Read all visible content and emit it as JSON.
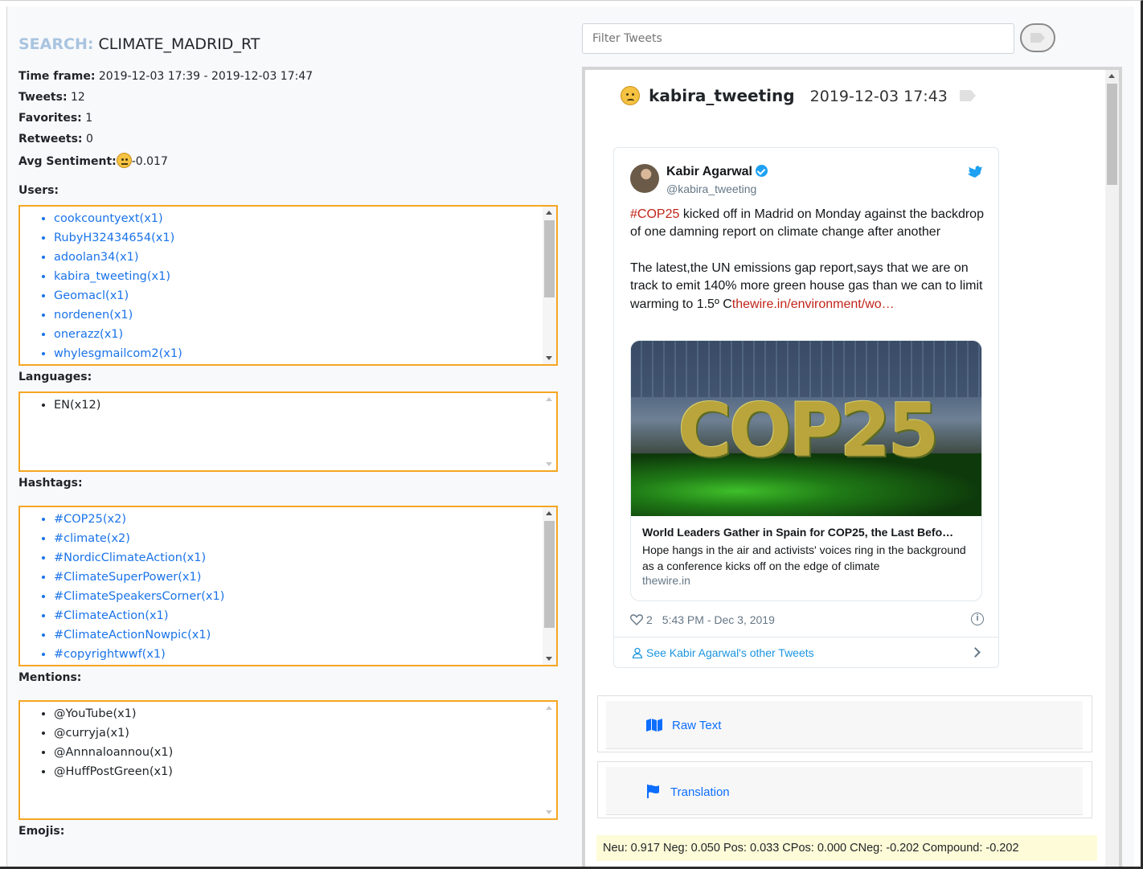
{
  "search": {
    "label": "SEARCH:",
    "value": "CLIMATE_MADRID_RT"
  },
  "stats": {
    "time_frame_label": "Time frame:",
    "time_frame": "2019-12-03 17:39 - 2019-12-03 17:47",
    "tweets_label": "Tweets:",
    "tweets": "12",
    "favorites_label": "Favorites:",
    "favorites": "1",
    "retweets_label": "Retweets:",
    "retweets": "0",
    "sentiment_label": "Avg Sentiment:",
    "sentiment": "-0.017"
  },
  "users": {
    "label": "Users:",
    "items": [
      "cookcountyext(x1)",
      "RubyH32434654(x1)",
      "adoolan34(x1)",
      "kabira_tweeting(x1)",
      "Geomacl(x1)",
      "nordenen(x1)",
      "onerazz(x1)",
      "whylesgmailcom2(x1)"
    ]
  },
  "languages": {
    "label": "Languages:",
    "items": [
      "EN(x12)"
    ]
  },
  "hashtags": {
    "label": "Hashtags:",
    "items": [
      "#COP25(x2)",
      "#climate(x2)",
      "#NordicClimateAction(x1)",
      "#ClimateSuperPower(x1)",
      "#ClimateSpeakersCorner(x1)",
      "#ClimateAction(x1)",
      "#ClimateActionNowpic(x1)",
      "#copyrightwwf(x1)"
    ]
  },
  "mentions": {
    "label": "Mentions:",
    "items": [
      "@YouTube(x1)",
      "@curryja(x1)",
      "@Annnaloannou(x1)",
      "@HuffPostGreen(x1)"
    ]
  },
  "emojis": {
    "label": "Emojis:"
  },
  "filter": {
    "placeholder": "Filter Tweets"
  },
  "tweet": {
    "user": "kabira_tweeting",
    "date": "2019-12-03 17:43",
    "author_name": "Kabir Agarwal",
    "author_handle": "@kabira_tweeting",
    "text_hashtag": "#COP25",
    "text_p1_rest": " kicked off in Madrid on Monday against the backdrop of one damning report on climate change after another",
    "text_p2": "The latest,the UN emissions gap report,says that we are on track to emit 140% more green house gas than we can to limit warming to 1.5º C",
    "text_link": "thewire.in/environment/wo…",
    "photo_text": "COP25",
    "card_title": "World Leaders Gather in Spain for COP25, the Last Befo…",
    "card_desc": "Hope hangs in the air and activists' voices ring in the background as a conference kicks off on the edge of climate",
    "card_domain": "thewire.in",
    "likes": "2",
    "time": "5:43 PM - Dec 3, 2019",
    "see_more": "See Kabir Agarwal's other Tweets"
  },
  "accordion": {
    "raw_text": "Raw Text",
    "translation": "Translation"
  },
  "sentiment_scores": "Neu: 0.917 Neg: 0.050 Pos: 0.033 CPos: 0.000 CNeg: -0.202 Compound: -0.202",
  "colors": {
    "link": "#1a73e8",
    "border_orange": "#f5a623",
    "hashtag_red": "#c02418",
    "twitter_blue": "#1da1f2"
  }
}
